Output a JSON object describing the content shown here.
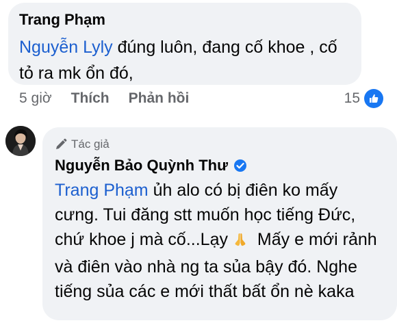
{
  "comment": {
    "author": "Trang Phạm",
    "mention": "Nguyễn Lyly",
    "text": " đúng luôn, đang cố khoe , cố tỏ ra mk ổn đó,",
    "time": "5 giờ",
    "like_label": "Thích",
    "reply_label": "Phản hồi",
    "reaction_count": "15"
  },
  "reply": {
    "badge": "Tác giả",
    "author": "Nguyễn Bảo Quỳnh Thư",
    "mention": "Trang Phạm",
    "text_part1": " ủh alo có bị điên ko mấy cưng. Tui đăng stt muốn học tiếng Đức, chứ khoe j mà cố...Lạy",
    "text_part2": " Mấy e mới rảnh và điên vào nhà ng ta sủa bậy đó. Nghe tiếng sủa các e mới thất bất ổn nè kaka"
  },
  "colors": {
    "bubble": "#f0f2f5",
    "mention": "#1c5fcf",
    "meta": "#65676b",
    "like": "#1877f2"
  },
  "icons": {
    "like": "thumbs-up-icon",
    "badge": "pen-icon",
    "verified": "verified-badge-icon",
    "emoji": "folded-hands-emoji"
  }
}
